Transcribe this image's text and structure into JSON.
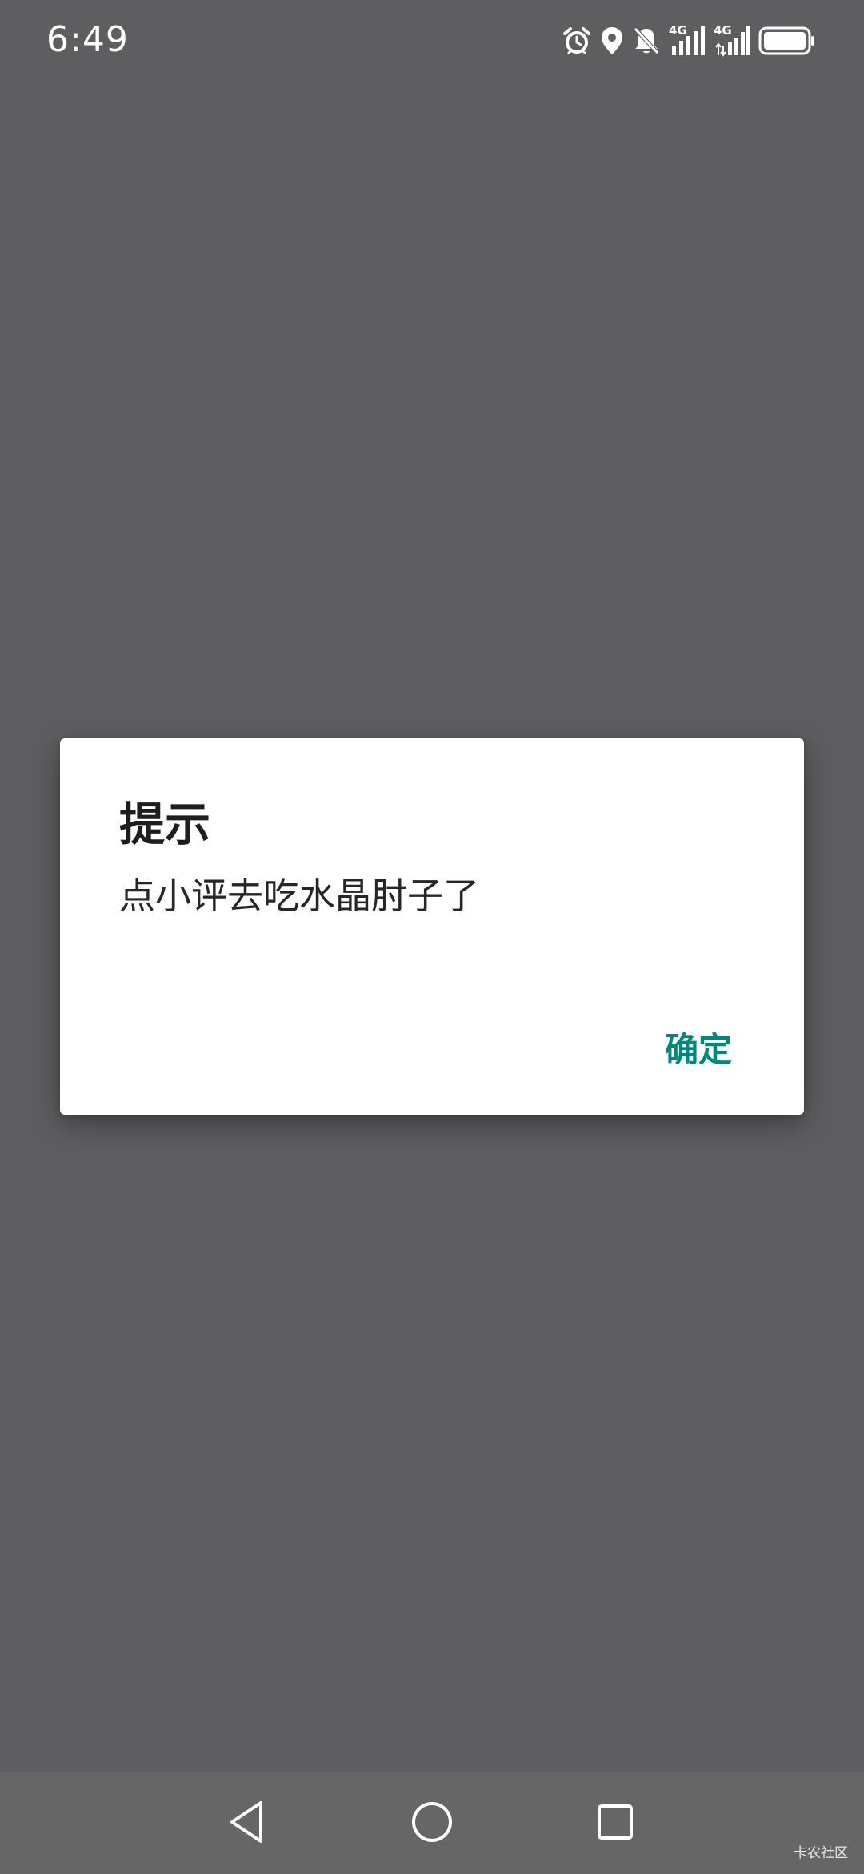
{
  "status_bar": {
    "time": "6:49",
    "icons": [
      "alarm-icon",
      "location-icon",
      "bell-off-icon",
      "signal-4g-icon",
      "signal-4g-icon",
      "battery-icon"
    ],
    "network_label_1": "4G",
    "network_label_2": "4G"
  },
  "dialog": {
    "title": "提示",
    "message": "点小评去吃水晶肘子了",
    "confirm_label": "确定"
  },
  "nav_bar": {
    "icons": [
      "back-triangle-icon",
      "home-circle-icon",
      "recents-square-icon"
    ]
  },
  "watermark": "卡农社区",
  "colors": {
    "scrim": "#5e5e60",
    "dialog_bg": "#ffffff",
    "accent": "#00897b",
    "nav_bg": "#666666"
  }
}
